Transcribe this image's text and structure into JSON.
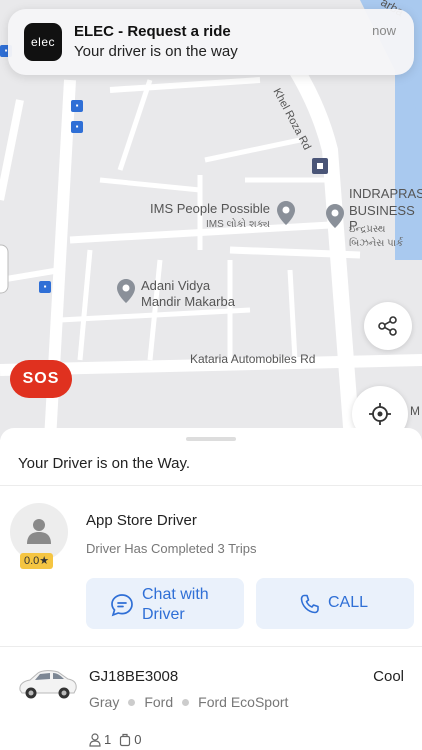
{
  "notification": {
    "app_icon_text": "elec",
    "title": "ELEC - Request a ride",
    "body": "Your driver is on the way",
    "time": "now"
  },
  "map": {
    "labels": {
      "road_top": "Khel Roza Rd",
      "ims": "IMS People Possible",
      "ims_local": "IMS લોકો શક્ય",
      "indraprastha_1": "INDRAPRAS",
      "indraprastha_2": "BUSINESS P",
      "indraprastha_local_1": "ઇન્દ્રપ્રસ્થ",
      "indraprastha_local_2": "બિઝનેસ પાર્ક",
      "adani_1": "Adani Vidya",
      "adani_2": "Mandir Makarba",
      "kataria": "Kataria Automobiles Rd",
      "corner_top": "arba",
      "corner_bottom": "M"
    }
  },
  "buttons": {
    "sos": "SOS"
  },
  "sheet": {
    "status": "Your Driver is on the Way.",
    "driver": {
      "rating": "0.0★",
      "name": "App Store Driver",
      "trips": "Driver Has Completed 3 Trips"
    },
    "actions": {
      "chat": "Chat with Driver",
      "call": "CALL"
    },
    "vehicle": {
      "plate": "GJ18BE3008",
      "class": "Cool",
      "color": "Gray",
      "make": "Ford",
      "model": "Ford EcoSport",
      "passengers": "1",
      "luggage": "0"
    }
  },
  "colors": {
    "accent": "#2f6fd6",
    "sos": "#e0311f",
    "action_bg": "#eaf1fb",
    "rating": "#f5c542"
  }
}
